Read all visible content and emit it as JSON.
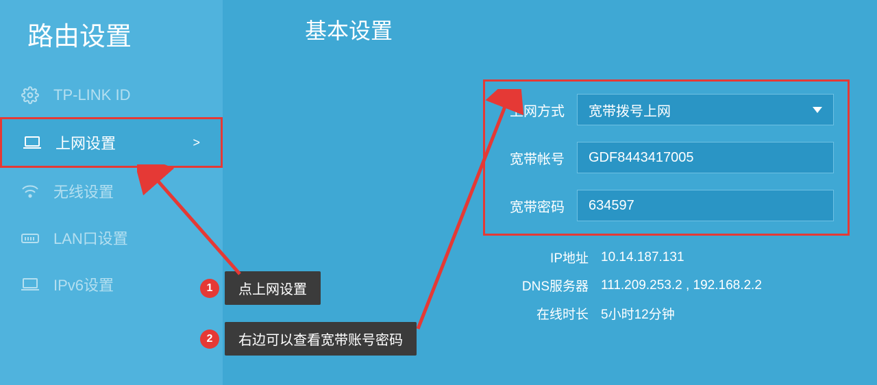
{
  "sidebar": {
    "title": "路由设置",
    "items": [
      {
        "label": "TP-LINK ID",
        "icon": "gear"
      },
      {
        "label": "上网设置",
        "icon": "laptop",
        "active": true
      },
      {
        "label": "无线设置",
        "icon": "wifi"
      },
      {
        "label": "LAN口设置",
        "icon": "lanport"
      },
      {
        "label": "IPv6设置",
        "icon": "laptop"
      }
    ]
  },
  "main": {
    "title": "基本设置",
    "fields": {
      "method_label": "上网方式",
      "method_value": "宽带拨号上网",
      "account_label": "宽带帐号",
      "account_value": "GDF8443417005",
      "password_label": "宽带密码",
      "password_value": "634597"
    },
    "info": {
      "ip_label": "IP地址",
      "ip_value": "10.14.187.131",
      "dns_label": "DNS服务器",
      "dns_value": "111.209.253.2 , 192.168.2.2",
      "uptime_label": "在线时长",
      "uptime_value": "5小时12分钟"
    }
  },
  "callouts": {
    "c1_num": "1",
    "c1_text": "点上网设置",
    "c2_num": "2",
    "c2_text": "右边可以查看宽带账号密码"
  }
}
